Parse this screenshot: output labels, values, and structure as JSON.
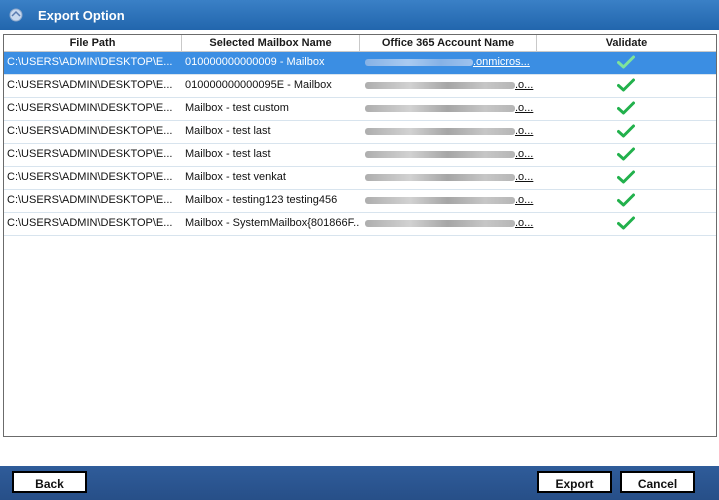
{
  "window": {
    "title": "Export Option",
    "icon": "app-icon"
  },
  "grid": {
    "columns": [
      "File Path",
      "Selected Mailbox Name",
      "Office 365 Account Name",
      "Validate"
    ],
    "rows": [
      {
        "path": "C:\\USERS\\ADMIN\\DESKTOP\\E...",
        "mailbox": "010000000000009 - Mailbox",
        "account": ".onmicros...",
        "validate": "check-icon",
        "selected": true
      },
      {
        "path": "C:\\USERS\\ADMIN\\DESKTOP\\E...",
        "mailbox": "010000000000095E - Mailbox",
        "account": ".o...",
        "validate": "check-icon",
        "selected": false
      },
      {
        "path": "C:\\USERS\\ADMIN\\DESKTOP\\E...",
        "mailbox": "Mailbox - test custom",
        "account": ".o...",
        "validate": "check-icon",
        "selected": false
      },
      {
        "path": "C:\\USERS\\ADMIN\\DESKTOP\\E...",
        "mailbox": "Mailbox - test last",
        "account": ".o...",
        "validate": "check-icon",
        "selected": false
      },
      {
        "path": "C:\\USERS\\ADMIN\\DESKTOP\\E...",
        "mailbox": "Mailbox - test last",
        "account": ".o...",
        "validate": "check-icon",
        "selected": false
      },
      {
        "path": "C:\\USERS\\ADMIN\\DESKTOP\\E...",
        "mailbox": "Mailbox - test venkat",
        "account": ".o...",
        "validate": "check-icon",
        "selected": false
      },
      {
        "path": "C:\\USERS\\ADMIN\\DESKTOP\\E...",
        "mailbox": "Mailbox - testing123 testing456",
        "account": ".o...",
        "validate": "check-icon",
        "selected": false
      },
      {
        "path": "C:\\USERS\\ADMIN\\DESKTOP\\E...",
        "mailbox": "Mailbox - SystemMailbox{801866F...",
        "account": ".o...",
        "validate": "check-icon",
        "selected": false
      }
    ]
  },
  "footer": {
    "back": "Back",
    "export": "Export",
    "cancel": "Cancel"
  },
  "colors": {
    "title_bar": "#2a70b8",
    "selection": "#3b8ee3",
    "footer": "#2b5591",
    "check": "#22b14c"
  }
}
